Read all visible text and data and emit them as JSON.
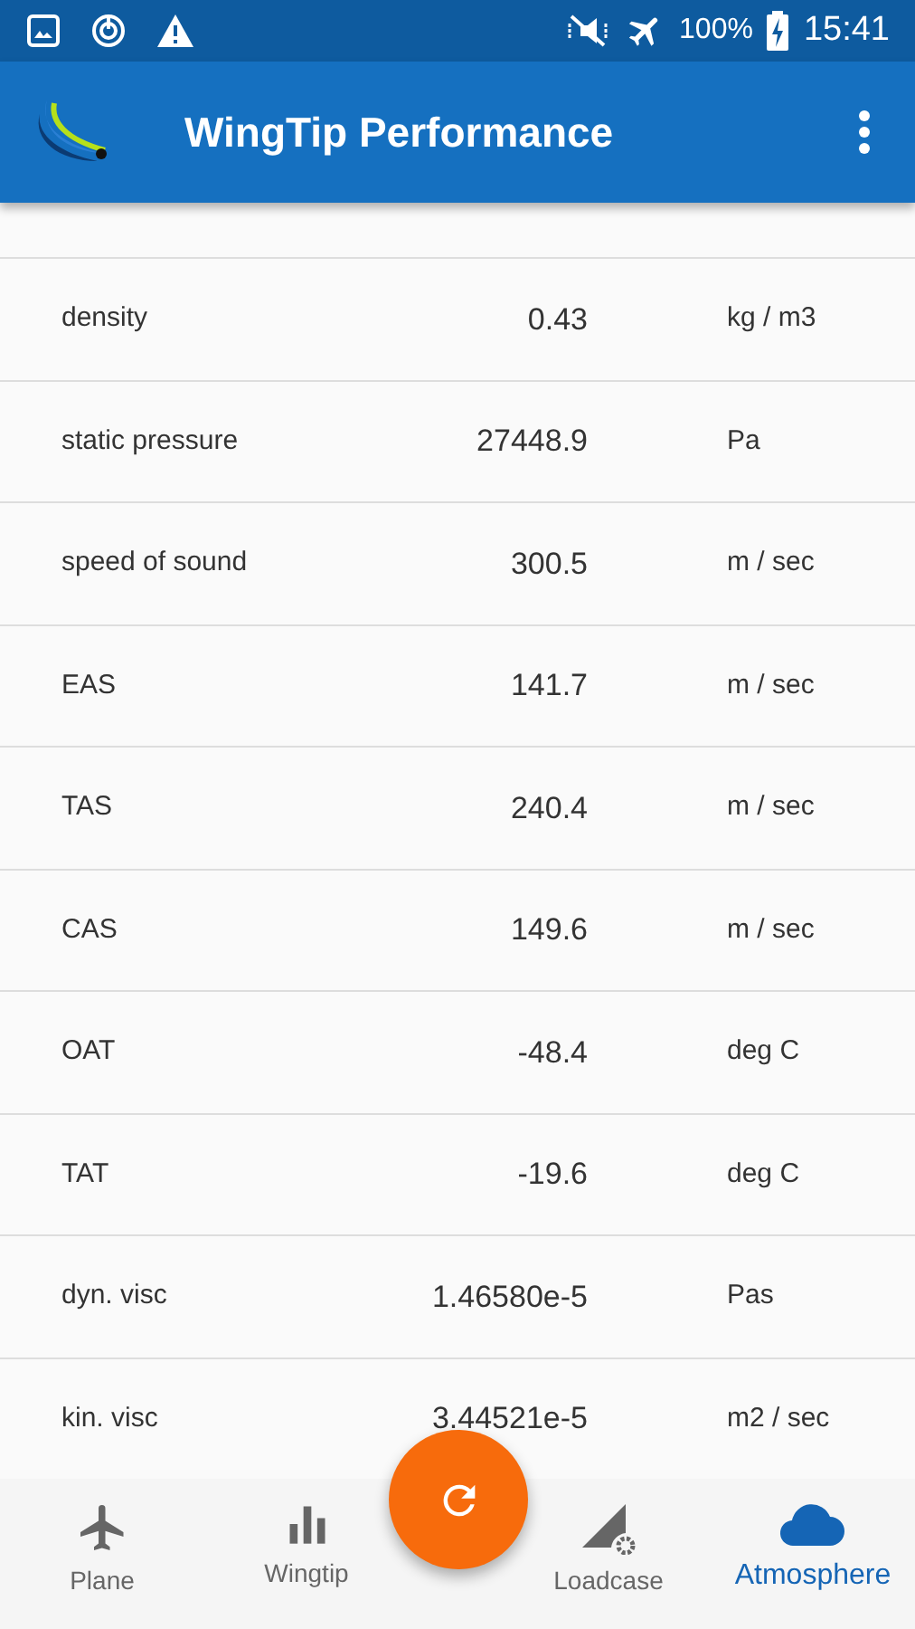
{
  "status_bar": {
    "battery": "100%",
    "time": "15:41"
  },
  "app_bar": {
    "title": "WingTip Performance"
  },
  "rows": [
    {
      "label": "density",
      "value": "0.43",
      "unit": "kg / m3"
    },
    {
      "label": "static pressure",
      "value": "27448.9",
      "unit": "Pa"
    },
    {
      "label": "speed of sound",
      "value": "300.5",
      "unit": "m / sec"
    },
    {
      "label": "EAS",
      "value": "141.7",
      "unit": "m / sec"
    },
    {
      "label": "TAS",
      "value": "240.4",
      "unit": "m / sec"
    },
    {
      "label": "CAS",
      "value": "149.6",
      "unit": "m / sec"
    },
    {
      "label": "OAT",
      "value": "-48.4",
      "unit": "deg C"
    },
    {
      "label": "TAT",
      "value": "-19.6",
      "unit": "deg C"
    },
    {
      "label": "dyn. visc",
      "value": "1.46580e-5",
      "unit": "Pas"
    },
    {
      "label": "kin. visc",
      "value": "3.44521e-5",
      "unit": "m2 / sec"
    }
  ],
  "bottom_nav": [
    {
      "label": "Plane",
      "kind": "plane",
      "selected": false
    },
    {
      "label": "Wingtip",
      "kind": "bars",
      "selected": false
    },
    {
      "label": "Loadcase",
      "kind": "loadcase",
      "selected": false
    },
    {
      "label": "Atmosphere",
      "kind": "cloud",
      "selected": true
    }
  ]
}
